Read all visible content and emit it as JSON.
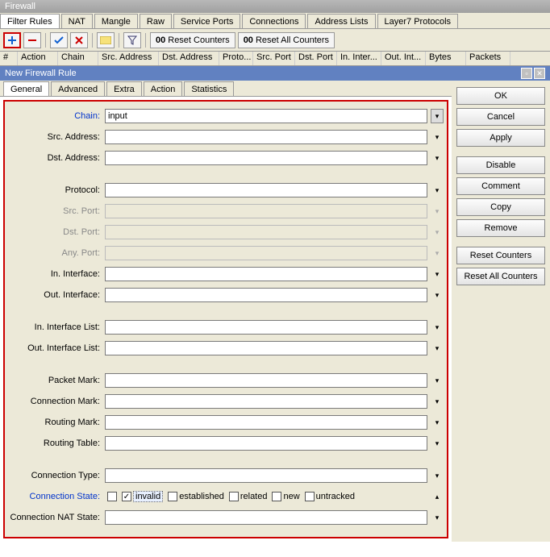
{
  "window": {
    "title": "Firewall"
  },
  "main_tabs": [
    {
      "label": "Filter Rules",
      "active": true
    },
    {
      "label": "NAT"
    },
    {
      "label": "Mangle"
    },
    {
      "label": "Raw"
    },
    {
      "label": "Service Ports"
    },
    {
      "label": "Connections"
    },
    {
      "label": "Address Lists"
    },
    {
      "label": "Layer7 Protocols"
    }
  ],
  "toolbar": {
    "reset_counters": "Reset Counters",
    "reset_all_counters": "Reset All Counters",
    "prefix": "00"
  },
  "columns": [
    "#",
    "Action",
    "Chain",
    "Src. Address",
    "Dst. Address",
    "Proto...",
    "Src. Port",
    "Dst. Port",
    "In. Inter...",
    "Out. Int...",
    "Bytes",
    "Packets"
  ],
  "dialog": {
    "title": "New Firewall Rule",
    "tabs": [
      {
        "label": "General",
        "active": true
      },
      {
        "label": "Advanced"
      },
      {
        "label": "Extra"
      },
      {
        "label": "Action"
      },
      {
        "label": "Statistics"
      }
    ],
    "fields": {
      "chain": {
        "label": "Chain:",
        "value": "input"
      },
      "src_address": {
        "label": "Src. Address:",
        "value": ""
      },
      "dst_address": {
        "label": "Dst. Address:",
        "value": ""
      },
      "protocol": {
        "label": "Protocol:",
        "value": ""
      },
      "src_port": {
        "label": "Src. Port:",
        "value": ""
      },
      "dst_port": {
        "label": "Dst. Port:",
        "value": ""
      },
      "any_port": {
        "label": "Any. Port:",
        "value": ""
      },
      "in_interface": {
        "label": "In. Interface:",
        "value": ""
      },
      "out_interface": {
        "label": "Out. Interface:",
        "value": ""
      },
      "in_interface_list": {
        "label": "In. Interface List:",
        "value": ""
      },
      "out_interface_list": {
        "label": "Out. Interface List:",
        "value": ""
      },
      "packet_mark": {
        "label": "Packet Mark:",
        "value": ""
      },
      "connection_mark": {
        "label": "Connection Mark:",
        "value": ""
      },
      "routing_mark": {
        "label": "Routing Mark:",
        "value": ""
      },
      "routing_table": {
        "label": "Routing Table:",
        "value": ""
      },
      "connection_type": {
        "label": "Connection Type:",
        "value": ""
      },
      "connection_state": {
        "label": "Connection State:"
      },
      "connection_nat_state": {
        "label": "Connection NAT State:",
        "value": ""
      }
    },
    "conn_states": [
      {
        "label": "invalid",
        "checked": true,
        "highlight": true
      },
      {
        "label": "established",
        "checked": false
      },
      {
        "label": "related",
        "checked": false
      },
      {
        "label": "new",
        "checked": false
      },
      {
        "label": "untracked",
        "checked": false
      }
    ],
    "buttons": {
      "ok": "OK",
      "cancel": "Cancel",
      "apply": "Apply",
      "disable": "Disable",
      "comment": "Comment",
      "copy": "Copy",
      "remove": "Remove",
      "reset_counters": "Reset Counters",
      "reset_all_counters": "Reset All Counters"
    }
  }
}
